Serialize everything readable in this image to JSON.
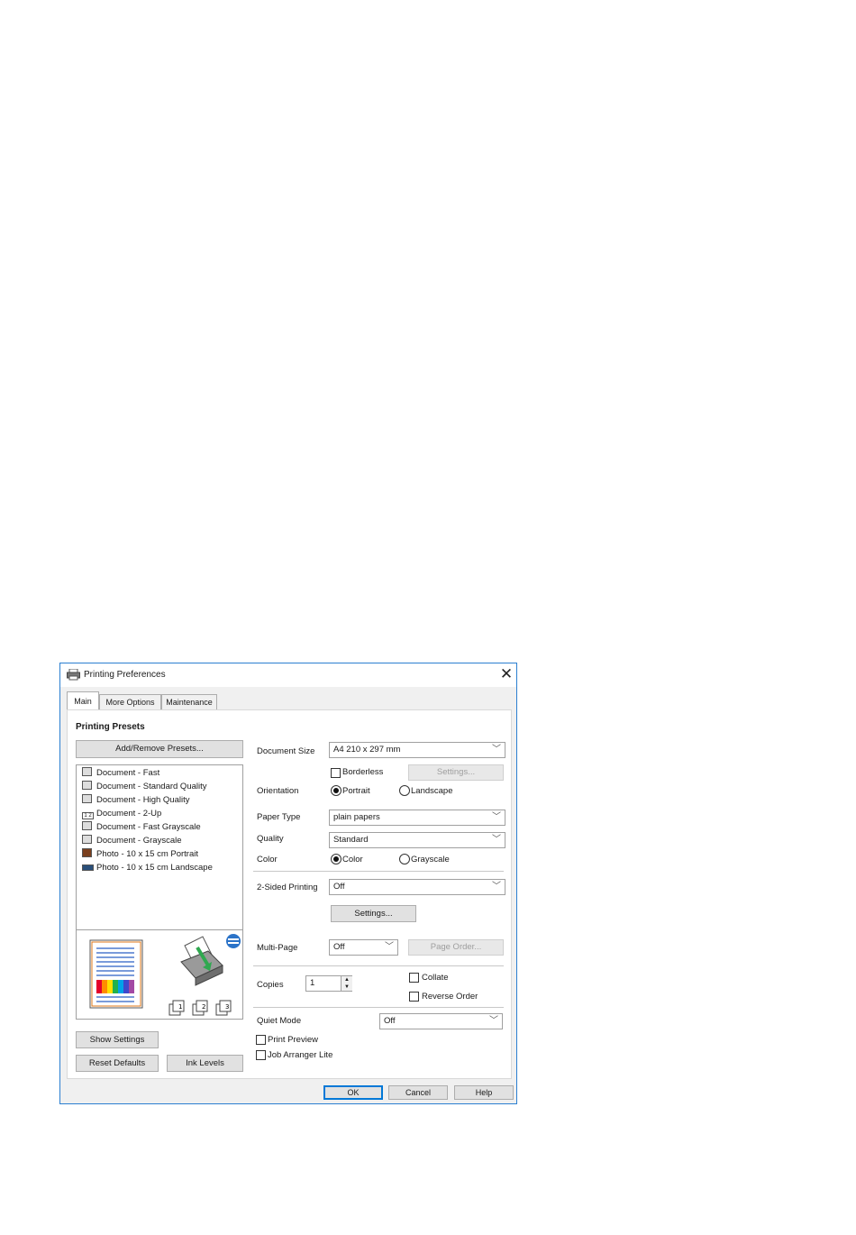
{
  "window": {
    "title": "Printing Preferences",
    "close": "✕"
  },
  "tabs": [
    {
      "label": "Main",
      "active": true
    },
    {
      "label": "More Options",
      "active": false
    },
    {
      "label": "Maintenance",
      "active": false
    }
  ],
  "presets": {
    "heading": "Printing Presets",
    "add_remove": "Add/Remove Presets...",
    "items": [
      {
        "label": "Document - Fast",
        "icon": "document-icon"
      },
      {
        "label": "Document - Standard Quality",
        "icon": "document-icon"
      },
      {
        "label": "Document - High Quality",
        "icon": "document-icon"
      },
      {
        "label": "Document - 2-Up",
        "icon": "two-up-icon"
      },
      {
        "label": "Document - Fast Grayscale",
        "icon": "document-icon"
      },
      {
        "label": "Document - Grayscale",
        "icon": "document-icon"
      },
      {
        "label": "Photo - 10 x 15 cm Portrait",
        "icon": "photo-portrait-icon"
      },
      {
        "label": "Photo - 10 x 15 cm Landscape",
        "icon": "photo-landscape-icon"
      }
    ]
  },
  "preview": {
    "stack_labels": [
      "1",
      "2",
      "3"
    ]
  },
  "left_buttons": {
    "show_settings": "Show Settings",
    "reset_defaults": "Reset Defaults",
    "ink_levels": "Ink Levels"
  },
  "settings": {
    "document_size": {
      "label": "Document Size",
      "value": "A4 210 x 297 mm"
    },
    "borderless": {
      "label": "Borderless",
      "checked": false
    },
    "borderless_settings": "Settings...",
    "orientation": {
      "label": "Orientation",
      "options": [
        "Portrait",
        "Landscape"
      ],
      "selected": "Portrait"
    },
    "paper_type": {
      "label": "Paper Type",
      "value": "plain papers"
    },
    "quality": {
      "label": "Quality",
      "value": "Standard"
    },
    "color": {
      "label": "Color",
      "options": [
        "Color",
        "Grayscale"
      ],
      "selected": "Color"
    },
    "two_sided": {
      "label": "2-Sided Printing",
      "value": "Off"
    },
    "two_sided_settings": "Settings...",
    "multi_page": {
      "label": "Multi-Page",
      "value": "Off"
    },
    "page_order": "Page Order...",
    "copies": {
      "label": "Copies",
      "value": "1"
    },
    "collate": {
      "label": "Collate",
      "checked": false
    },
    "reverse_order": {
      "label": "Reverse Order",
      "checked": false
    },
    "quiet_mode": {
      "label": "Quiet Mode",
      "value": "Off"
    },
    "print_preview": {
      "label": "Print Preview",
      "checked": false
    },
    "job_arranger": {
      "label": "Job Arranger Lite",
      "checked": false
    }
  },
  "footer": {
    "ok": "OK",
    "cancel": "Cancel",
    "help": "Help"
  },
  "colors": {
    "accent": "#0078d7",
    "window_border": "#2b7fd1",
    "dialog_bg": "#f0f0f0"
  }
}
